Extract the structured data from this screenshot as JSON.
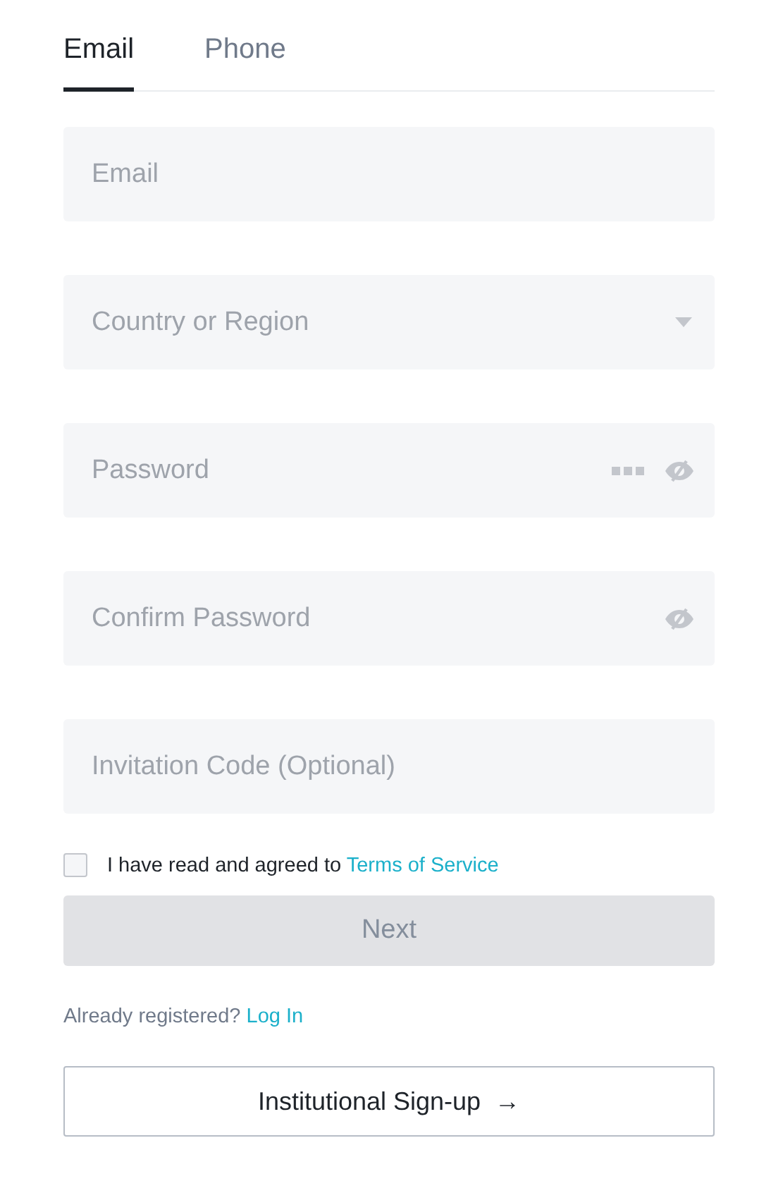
{
  "tabs": [
    {
      "label": "Email",
      "selected": true
    },
    {
      "label": "Phone",
      "selected": false
    }
  ],
  "fields": [
    {
      "kind": "text",
      "placeholder": "Email"
    },
    {
      "kind": "select",
      "placeholder": "Country or Region"
    },
    {
      "kind": "password_generate",
      "placeholder": "Password"
    },
    {
      "kind": "password",
      "placeholder": "Confirm Password"
    },
    {
      "kind": "text",
      "placeholder": "Invitation Code (Optional)"
    }
  ],
  "agreement": {
    "checked": false,
    "text": "I have read and agreed to",
    "link": "Terms of Service"
  },
  "next_button": {
    "label": "Next",
    "disabled": true
  },
  "login_prompt": {
    "text": "Already registered?",
    "link": "Log In"
  },
  "institutional_button": {
    "label": "Institutional Sign-up",
    "arrow": "→"
  }
}
